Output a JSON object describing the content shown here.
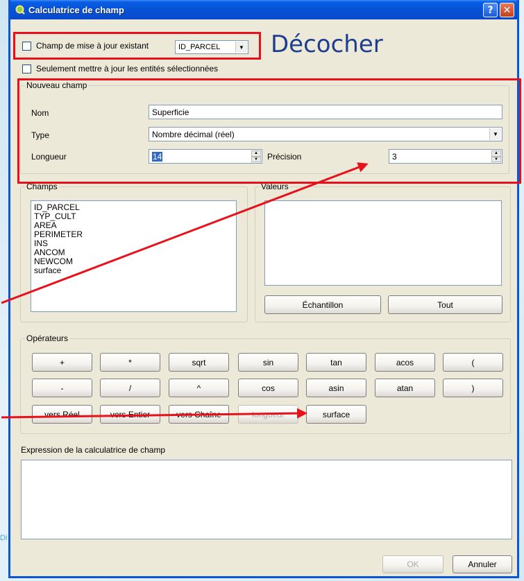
{
  "window": {
    "title": "Calculatrice de champ",
    "help_label": "?",
    "close_label": "✕"
  },
  "update_existing": {
    "label": "Champ de mise à jour existant",
    "field_value": "ID_PARCEL"
  },
  "selected_only": {
    "label": "Seulement mettre à jour les entités sélectionnées"
  },
  "annotation": "Décocher",
  "new_field": {
    "group_title": "Nouveau champ",
    "name_label": "Nom",
    "name_value": "Superficie",
    "type_label": "Type",
    "type_value": "Nombre décimal (réel)",
    "length_label": "Longueur",
    "length_value": "14",
    "precision_label": "Précision",
    "precision_value": "3"
  },
  "fields": {
    "group_title": "Champs",
    "items": [
      "ID_PARCEL",
      "TYP_CULT",
      "AREA",
      "PERIMETER",
      "INS",
      "ANCOM",
      "NEWCOM",
      "surface"
    ]
  },
  "values": {
    "group_title": "Valeurs",
    "sample_label": "Échantillon",
    "all_label": "Tout"
  },
  "operators": {
    "group_title": "Opérateurs",
    "row1": [
      "+",
      "*",
      "sqrt",
      "sin",
      "tan",
      "acos",
      "("
    ],
    "row2": [
      "-",
      "/",
      "^",
      "cos",
      "asin",
      "atan",
      ")"
    ],
    "row3": [
      "vers Réel",
      "vers Entier",
      "vers Chaîne",
      "longueur",
      "surface"
    ]
  },
  "expression": {
    "label": "Expression de la calculatrice de champ"
  },
  "footer": {
    "ok_label": "OK",
    "cancel_label": "Annuler"
  },
  "watermark": "Di",
  "colors": {
    "annotation": "#1f3d8f",
    "highlight": "#e8111b",
    "titlebar": "#0a55d8"
  }
}
